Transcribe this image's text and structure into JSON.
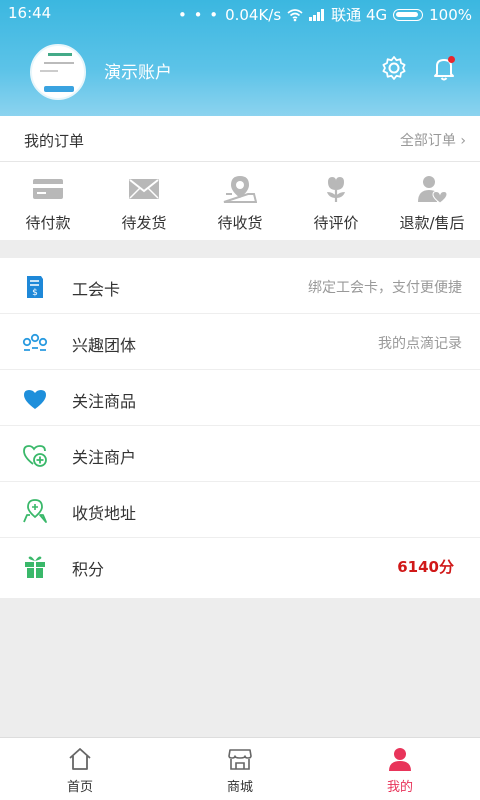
{
  "status_bar": {
    "time": "16:44",
    "indicators": "• • •",
    "speed": "0.04K/s",
    "carrier": "联通 4G",
    "battery": "100%"
  },
  "header": {
    "account_name": "演示账户",
    "avatar_text": "爱特公寓"
  },
  "orders": {
    "title": "我的订单",
    "all_label": "全部订单 ›",
    "items": [
      {
        "label": "待付款",
        "icon": "card-icon"
      },
      {
        "label": "待发货",
        "icon": "envelope-icon"
      },
      {
        "label": "待收货",
        "icon": "map-pin-icon"
      },
      {
        "label": "待评价",
        "icon": "flower-icon"
      },
      {
        "label": "退款/售后",
        "icon": "user-heart-icon"
      }
    ]
  },
  "menu": [
    {
      "label": "工会卡",
      "hint": "绑定工会卡，支付更便捷",
      "icon": "union-card-icon"
    },
    {
      "label": "兴趣团体",
      "hint": "我的点滴记录",
      "icon": "group-icon"
    },
    {
      "label": "关注商品",
      "hint": "",
      "icon": "heart-icon"
    },
    {
      "label": "关注商户",
      "hint": "",
      "icon": "heart-plus-icon"
    },
    {
      "label": "收货地址",
      "hint": "",
      "icon": "address-icon"
    },
    {
      "label": "积分",
      "hint": "",
      "points": "6140分",
      "icon": "gift-icon"
    }
  ],
  "tabbar": [
    {
      "label": "首页",
      "icon": "home-icon"
    },
    {
      "label": "商城",
      "icon": "store-icon"
    },
    {
      "label": "我的",
      "icon": "user-icon",
      "active": true
    }
  ],
  "colors": {
    "header_blue": "#3bb7e0",
    "accent_pink": "#e8345a",
    "points_red": "#d01818",
    "icon_grey": "#b8b8b8"
  }
}
